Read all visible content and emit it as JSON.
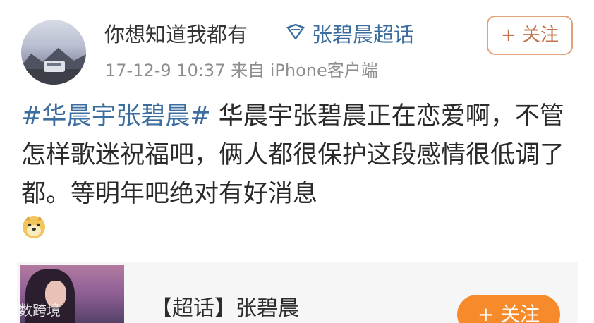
{
  "header": {
    "username": "你想知道我都有",
    "topic_link": "张碧晨超话",
    "meta": "17-12-9 10:37  来自 iPhone客户端",
    "follow_label": "+ 关注"
  },
  "post": {
    "hashtag": "#华晨宇张碧晨#",
    "text": " 华晨宇张碧晨正在恋爱啊，不管怎样歌迷祝福吧，俩人都很保护这段感情很低调了都。等明年吧绝对有好消息",
    "emoji": "doge-emoji"
  },
  "card": {
    "title": "【超话】张碧晨",
    "follow_label": "+ 关注"
  },
  "watermark": "六数跨境"
}
